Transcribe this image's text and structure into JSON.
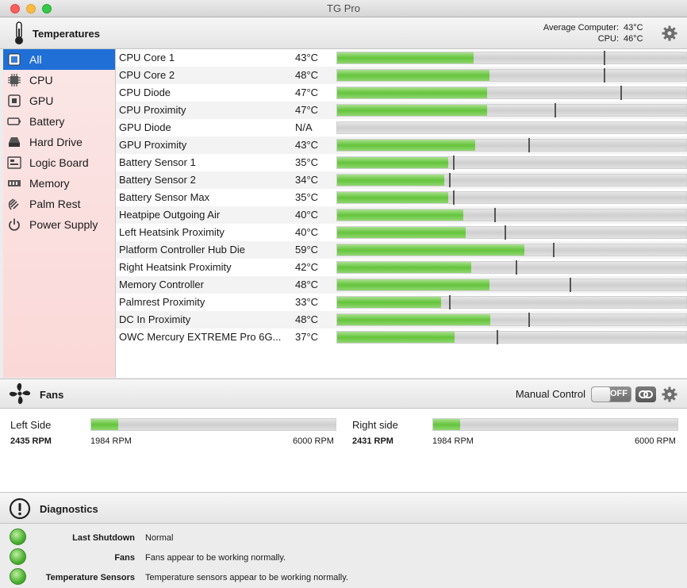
{
  "window": {
    "title": "TG Pro"
  },
  "temperatures": {
    "title": "Temperatures",
    "average_label": "Average Computer:",
    "average_value": "43°C",
    "cpu_label": "CPU:",
    "cpu_value": "46°C",
    "sensors": [
      {
        "name": "CPU Core 1",
        "value": "43°C",
        "fill": 0.39,
        "max": 0.76
      },
      {
        "name": "CPU Core 2",
        "value": "48°C",
        "fill": 0.435,
        "max": 0.76
      },
      {
        "name": "CPU Diode",
        "value": "47°C",
        "fill": 0.428,
        "max": 0.807
      },
      {
        "name": "CPU Proximity",
        "value": "47°C",
        "fill": 0.428,
        "max": 0.62
      },
      {
        "name": "GPU Diode",
        "value": "N/A",
        "fill": 0,
        "max": null
      },
      {
        "name": "GPU Proximity",
        "value": "43°C",
        "fill": 0.393,
        "max": 0.545
      },
      {
        "name": "Battery Sensor 1",
        "value": "35°C",
        "fill": 0.316,
        "max": 0.33
      },
      {
        "name": "Battery Sensor 2",
        "value": "34°C",
        "fill": 0.306,
        "max": 0.318
      },
      {
        "name": "Battery Sensor Max",
        "value": "35°C",
        "fill": 0.316,
        "max": 0.33
      },
      {
        "name": "Heatpipe Outgoing Air",
        "value": "40°C",
        "fill": 0.36,
        "max": 0.447
      },
      {
        "name": "Left Heatsink Proximity",
        "value": "40°C",
        "fill": 0.366,
        "max": 0.477
      },
      {
        "name": "Platform Controller Hub Die",
        "value": "59°C",
        "fill": 0.535,
        "max": 0.615
      },
      {
        "name": "Right Heatsink Proximity",
        "value": "42°C",
        "fill": 0.382,
        "max": 0.508
      },
      {
        "name": "Memory Controller",
        "value": "48°C",
        "fill": 0.435,
        "max": 0.663
      },
      {
        "name": "Palmrest Proximity",
        "value": "33°C",
        "fill": 0.297,
        "max": 0.318
      },
      {
        "name": "DC In Proximity",
        "value": "48°C",
        "fill": 0.437,
        "max": 0.545
      },
      {
        "name": "OWC Mercury EXTREME Pro 6G...",
        "value": "37°C",
        "fill": 0.335,
        "max": 0.455
      }
    ]
  },
  "sidebar": {
    "items": [
      {
        "label": "All",
        "icon": "all-icon",
        "active": true
      },
      {
        "label": "CPU",
        "icon": "cpu-icon",
        "active": false
      },
      {
        "label": "GPU",
        "icon": "gpu-icon",
        "active": false
      },
      {
        "label": "Battery",
        "icon": "battery-icon",
        "active": false
      },
      {
        "label": "Hard Drive",
        "icon": "hard-drive-icon",
        "active": false
      },
      {
        "label": "Logic Board",
        "icon": "logic-board-icon",
        "active": false
      },
      {
        "label": "Memory",
        "icon": "memory-icon",
        "active": false
      },
      {
        "label": "Palm Rest",
        "icon": "palm-rest-icon",
        "active": false
      },
      {
        "label": "Power Supply",
        "icon": "power-icon",
        "active": false
      }
    ]
  },
  "fans": {
    "title": "Fans",
    "manual_control_label": "Manual Control",
    "toggle_label": "OFF",
    "items": [
      {
        "name": "Left Side",
        "rpm": "2435 RPM",
        "min": "1984 RPM",
        "max": "6000 RPM",
        "fill": 0.11
      },
      {
        "name": "Right side",
        "rpm": "2431 RPM",
        "min": "1984 RPM",
        "max": "6000 RPM",
        "fill": 0.11
      }
    ]
  },
  "diagnostics": {
    "title": "Diagnostics",
    "rows": [
      {
        "label": "Last Shutdown",
        "value": "Normal",
        "status_color": "#4caf32"
      },
      {
        "label": "Fans",
        "value": "Fans appear to be working normally.",
        "status_color": "#4caf32"
      },
      {
        "label": "Temperature Sensors",
        "value": "Temperature sensors appear to be working normally.",
        "status_color": "#4caf32"
      }
    ]
  }
}
